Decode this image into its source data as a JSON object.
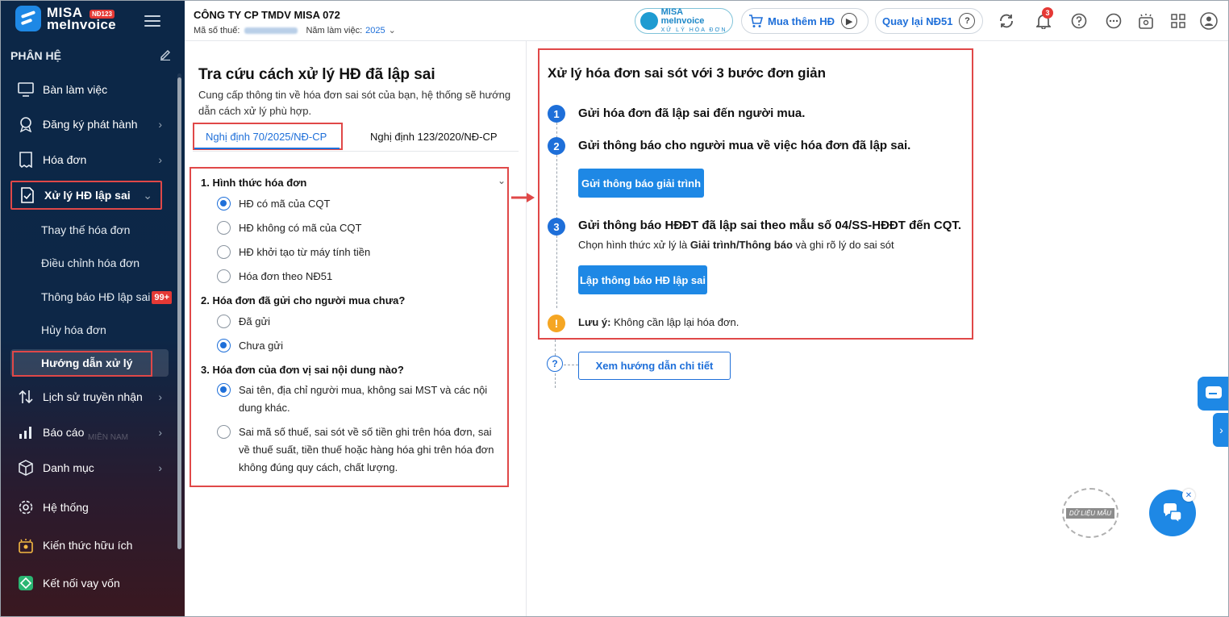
{
  "app": {
    "brand_line1": "MISA",
    "brand_line2": "meInvoice",
    "brand_badge": "NĐ123"
  },
  "header": {
    "company_name": "CÔNG TY CP TMDV MISA 072",
    "tax_label": "Mã số thuế:",
    "year_label": "Năm làm việc:",
    "year_value": "2025",
    "misa_pill_line1": "MISA meInvoice",
    "misa_pill_line2": "XỬ LÝ HÓA ĐƠN",
    "buy_more_label": "Mua thêm HĐ",
    "back_nd51_label": "Quay lại NĐ51",
    "notification_count": "3"
  },
  "sidebar": {
    "section_label": "PHÂN HỆ",
    "items": [
      {
        "label": "Bàn làm việc",
        "icon": "desktop-icon"
      },
      {
        "label": "Đăng ký phát hành",
        "icon": "register-icon"
      },
      {
        "label": "Hóa đơn",
        "icon": "invoice-icon"
      },
      {
        "label": "Xử lý HĐ lập sai",
        "icon": "fix-invoice-icon"
      },
      {
        "label": "Lịch sử truyền nhận",
        "icon": "transfer-icon"
      },
      {
        "label": "Báo cáo",
        "icon": "report-icon"
      },
      {
        "label": "Danh mục",
        "icon": "catalog-icon"
      },
      {
        "label": "Hệ thống",
        "icon": "settings-icon"
      },
      {
        "label": "Kiến thức hữu ích",
        "icon": "knowledge-icon"
      },
      {
        "label": "Kết nối vay vốn",
        "icon": "loan-icon"
      }
    ],
    "sub_items": [
      {
        "label": "Thay thế hóa đơn"
      },
      {
        "label": "Điều chỉnh hóa đơn"
      },
      {
        "label": "Thông báo HĐ lập sai",
        "badge": "99+"
      },
      {
        "label": "Hủy hóa đơn"
      },
      {
        "label": "Hướng dẫn xử lý"
      }
    ],
    "watermark_text": "MIỀN NAM"
  },
  "left_panel": {
    "title": "Tra cứu cách xử lý HĐ đã lập sai",
    "description": "Cung cấp thông tin về hóa đơn sai sót của bạn, hệ thống sẽ hướng dẫn cách xử lý phù hợp.",
    "tabs": [
      {
        "label": "Nghị định 70/2025/NĐ-CP",
        "active": true
      },
      {
        "label": "Nghị định 123/2020/NĐ-CP",
        "active": false
      }
    ],
    "questions": [
      {
        "title": "1. Hình thức hóa đơn",
        "options": [
          {
            "label": "HĐ có mã của CQT",
            "selected": true
          },
          {
            "label": "HĐ không có mã của CQT",
            "selected": false
          },
          {
            "label": "HĐ khởi tạo từ máy tính tiền",
            "selected": false
          },
          {
            "label": "Hóa đơn theo NĐ51",
            "selected": false
          }
        ]
      },
      {
        "title": "2. Hóa đơn đã gửi cho người mua chưa?",
        "options": [
          {
            "label": "Đã gửi",
            "selected": false
          },
          {
            "label": "Chưa gửi",
            "selected": true
          }
        ]
      },
      {
        "title": "3. Hóa đơn của đơn vị sai nội dung nào?",
        "options": [
          {
            "label": "Sai tên, địa chỉ người mua, không sai MST và các nội dung khác.",
            "selected": true
          },
          {
            "label": "Sai mã số thuế, sai sót về số tiền ghi trên hóa đơn, sai về thuế suất, tiền thuế hoặc hàng hóa ghi trên hóa đơn không đúng quy cách, chất lượng.",
            "selected": false
          }
        ]
      }
    ]
  },
  "right_panel": {
    "title": "Xử lý hóa đơn sai sót với 3 bước đơn giản",
    "steps": [
      {
        "num": "1",
        "text": "Gửi hóa đơn đã lập sai đến người mua."
      },
      {
        "num": "2",
        "text": "Gửi thông báo cho người mua về việc hóa đơn đã lập sai.",
        "button": "Gửi thông báo giải trình"
      },
      {
        "num": "3",
        "text": "Gửi thông báo HĐĐT đã lập sai theo mẫu số 04/SS-HĐĐT đến CQT.",
        "sub_prefix": "Chọn hình thức xử lý là ",
        "sub_bold": "Giải trình/Thông báo",
        "sub_suffix": " và ghi rõ lý do sai sót",
        "button": "Lập thông báo HĐ lập sai"
      }
    ],
    "note_label": "Lưu ý:",
    "note_text": " Không cần lập lại hóa đơn.",
    "guide_button": "Xem hướng dẫn chi tiết"
  },
  "floating": {
    "stamp_text": "DỮ LIỆU MẪU"
  },
  "colors": {
    "accent": "#1e6fd9",
    "highlight_border": "#e04848",
    "sidebar_bg": "#0c2747"
  }
}
